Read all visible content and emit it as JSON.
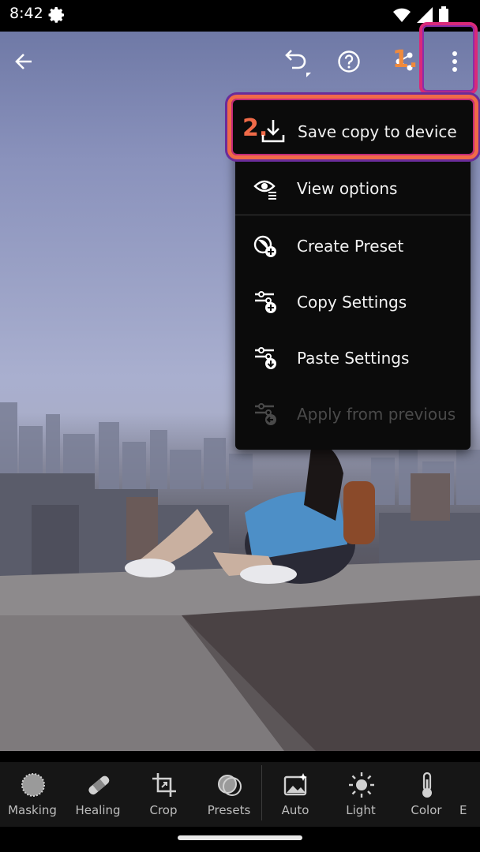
{
  "status_bar": {
    "time": "8:42"
  },
  "toolbar": {
    "back": "arrow-left-icon",
    "undo": "undo-icon",
    "help": "help-icon",
    "share": "share-icon",
    "more": "more-vertical-icon"
  },
  "annotations": {
    "step1": "1.",
    "step2": "2."
  },
  "menu": {
    "items": [
      {
        "label": "Save copy to device",
        "icon": "download-icon",
        "enabled": true
      },
      {
        "label": "View options",
        "icon": "eye-icon",
        "enabled": true
      },
      {
        "label": "Create Preset",
        "icon": "create-preset-icon",
        "enabled": true
      },
      {
        "label": "Copy Settings",
        "icon": "copy-settings-icon",
        "enabled": true
      },
      {
        "label": "Paste Settings",
        "icon": "paste-settings-icon",
        "enabled": true
      },
      {
        "label": "Apply from previous",
        "icon": "apply-previous-icon",
        "enabled": false
      }
    ]
  },
  "tools": [
    {
      "label": "Masking",
      "icon": "masking-icon"
    },
    {
      "label": "Healing",
      "icon": "bandage-icon"
    },
    {
      "label": "Crop",
      "icon": "crop-icon"
    },
    {
      "label": "Presets",
      "icon": "presets-icon"
    },
    {
      "label": "Auto",
      "icon": "auto-icon"
    },
    {
      "label": "Light",
      "icon": "sun-icon"
    },
    {
      "label": "Color",
      "icon": "thermometer-icon"
    },
    {
      "label": "E",
      "icon": "effects-icon"
    }
  ],
  "colors": {
    "highlight_pink": "#d9297a",
    "highlight_orange": "#f06a48",
    "highlight_purple": "#6a2c9a"
  }
}
